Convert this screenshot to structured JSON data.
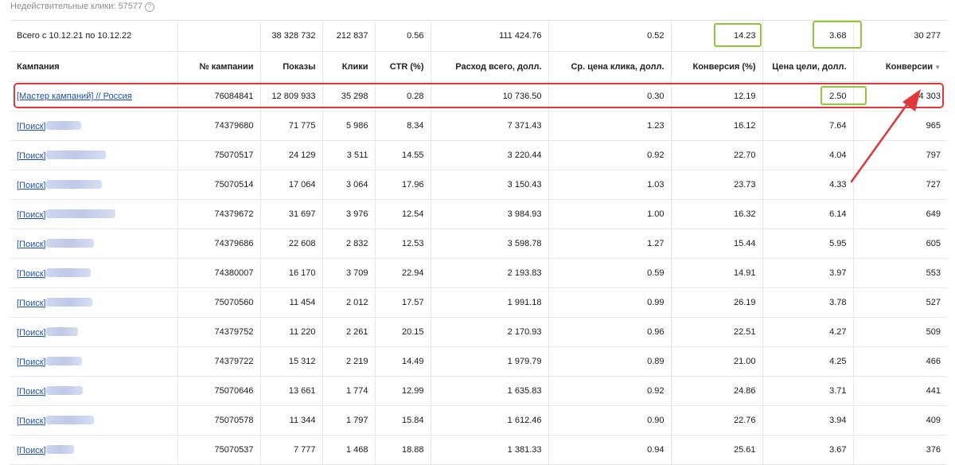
{
  "invalid_clicks": {
    "label": "Недействительные клики: 57577",
    "help_icon": "question-circle-icon"
  },
  "total": {
    "label": "Всего с 10.12.21 по 10.12.22",
    "impressions": "38 328 732",
    "clicks": "212 837",
    "ctr": "0.56",
    "cost": "111 424.76",
    "avg_cpc": "0.52",
    "conv_rate": "14.23",
    "cpa": "3.68",
    "conversions": "30 277"
  },
  "columns": {
    "campaign": "Кампания",
    "id": "№ кампании",
    "impressions": "Показы",
    "clicks": "Клики",
    "ctr": "CTR (%)",
    "cost": "Расход всего, долл.",
    "avg_cpc": "Ср. цена клика, долл.",
    "conv_rate": "Конверсия (%)",
    "cpa": "Цена цели, долл.",
    "conversions": "Конверсии",
    "sort_icon": "sort-desc-icon"
  },
  "rows": [
    {
      "name": "[Мастер кампаний] // Россия",
      "id": "76084841",
      "impressions": "12 809 933",
      "clicks": "35 298",
      "ctr": "0.28",
      "cost": "10 736.50",
      "avg_cpc": "0.30",
      "conv_rate": "12.19",
      "cpa": "2.50",
      "conversions": "4 303"
    },
    {
      "name": "[Поиск]",
      "id": "74379680",
      "impressions": "71 775",
      "clicks": "5 986",
      "ctr": "8.34",
      "cost": "7 371.43",
      "avg_cpc": "1.23",
      "conv_rate": "16.12",
      "cpa": "7.64",
      "conversions": "965"
    },
    {
      "name": "[Поиск]",
      "id": "75070517",
      "impressions": "24 129",
      "clicks": "3 511",
      "ctr": "14.55",
      "cost": "3 220.44",
      "avg_cpc": "0.92",
      "conv_rate": "22.70",
      "cpa": "4.04",
      "conversions": "797"
    },
    {
      "name": "[Поиск]",
      "id": "75070514",
      "impressions": "17 064",
      "clicks": "3 064",
      "ctr": "17.96",
      "cost": "3 150.43",
      "avg_cpc": "1.03",
      "conv_rate": "23.73",
      "cpa": "4.33",
      "conversions": "727"
    },
    {
      "name": "[Поиск]",
      "id": "74379672",
      "impressions": "31 697",
      "clicks": "3 976",
      "ctr": "12.54",
      "cost": "3 984.93",
      "avg_cpc": "1.00",
      "conv_rate": "16.32",
      "cpa": "6.14",
      "conversions": "649"
    },
    {
      "name": "[Поиск]",
      "id": "74379686",
      "impressions": "22 608",
      "clicks": "2 832",
      "ctr": "12.53",
      "cost": "3 598.78",
      "avg_cpc": "1.27",
      "conv_rate": "15.44",
      "cpa": "5.95",
      "conversions": "605"
    },
    {
      "name": "[Поиск]",
      "id": "74380007",
      "impressions": "16 170",
      "clicks": "3 709",
      "ctr": "22.94",
      "cost": "2 193.83",
      "avg_cpc": "0.59",
      "conv_rate": "14.91",
      "cpa": "3.97",
      "conversions": "553"
    },
    {
      "name": "[Поиск]",
      "id": "75070560",
      "impressions": "11 454",
      "clicks": "2 012",
      "ctr": "17.57",
      "cost": "1 991.18",
      "avg_cpc": "0.99",
      "conv_rate": "26.19",
      "cpa": "3.78",
      "conversions": "527"
    },
    {
      "name": "[Поиск]",
      "id": "74379752",
      "impressions": "11 220",
      "clicks": "2 261",
      "ctr": "20.15",
      "cost": "2 170.93",
      "avg_cpc": "0.96",
      "conv_rate": "22.51",
      "cpa": "4.27",
      "conversions": "509"
    },
    {
      "name": "[Поиск]",
      "id": "74379722",
      "impressions": "15 312",
      "clicks": "2 219",
      "ctr": "14.49",
      "cost": "1 979.79",
      "avg_cpc": "0.89",
      "conv_rate": "21.00",
      "cpa": "4.25",
      "conversions": "466"
    },
    {
      "name": "[Поиск]",
      "id": "75070646",
      "impressions": "13 661",
      "clicks": "1 774",
      "ctr": "12.99",
      "cost": "1 635.83",
      "avg_cpc": "0.92",
      "conv_rate": "24.86",
      "cpa": "3.71",
      "conversions": "441"
    },
    {
      "name": "[Поиск]",
      "id": "75070578",
      "impressions": "11 344",
      "clicks": "1 797",
      "ctr": "15.84",
      "cost": "1 612.46",
      "avg_cpc": "0.90",
      "conv_rate": "22.76",
      "cpa": "3.94",
      "conversions": "409"
    },
    {
      "name": "[Поиск]",
      "id": "75070537",
      "impressions": "7 777",
      "clicks": "1 468",
      "ctr": "18.88",
      "cost": "1 381.33",
      "avg_cpc": "0.94",
      "conv_rate": "25.61",
      "cpa": "3.67",
      "conversions": "376"
    }
  ],
  "annotations": {
    "highlight_color": "#e0383a",
    "box_color": "#92c63a",
    "blur_color": "#b7c3e6"
  }
}
